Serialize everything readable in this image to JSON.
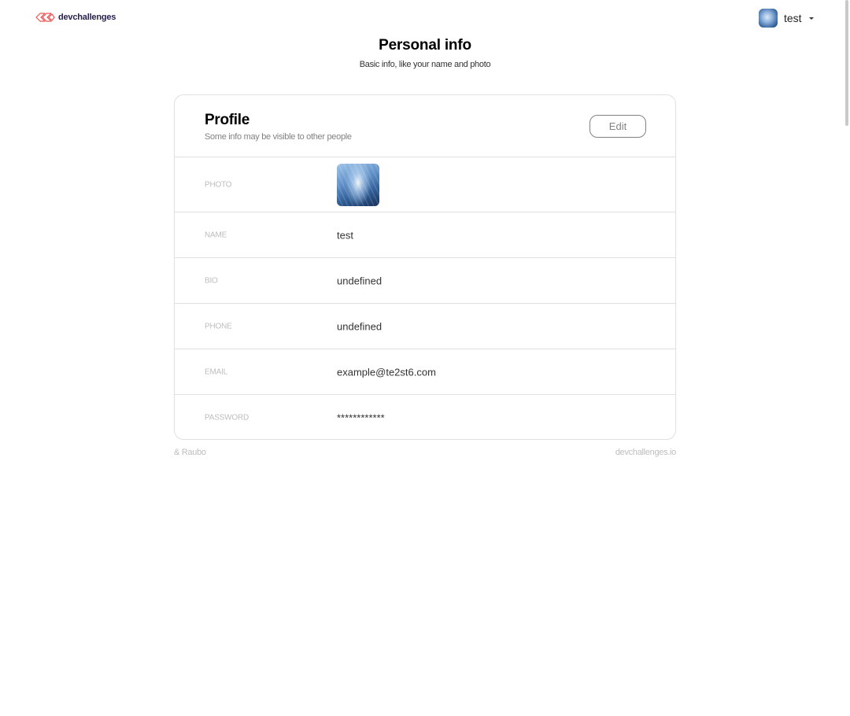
{
  "header": {
    "logo_text": "devchallenges",
    "logo_icon": "devchallenges-logo-icon",
    "user_name": "test",
    "menu_icon": "caret-down-icon"
  },
  "page": {
    "title": "Personal info",
    "subtitle": "Basic info, like your name and photo"
  },
  "profile": {
    "title": "Profile",
    "subtitle": "Some info may be visible to other people",
    "edit_label": "Edit",
    "rows": [
      {
        "label": "PHOTO",
        "value": ""
      },
      {
        "label": "NAME",
        "value": "test"
      },
      {
        "label": "BIO",
        "value": "undefined"
      },
      {
        "label": "PHONE",
        "value": "undefined"
      },
      {
        "label": "EMAIL",
        "value": "example@te2st6.com"
      },
      {
        "label": "PASSWORD",
        "value": "************"
      }
    ]
  },
  "footer": {
    "left": "& Raubo",
    "right": "devchallenges.io"
  },
  "colors": {
    "logo_accent": "#eb5757",
    "logo_text": "#282051",
    "muted_text": "#bdbdbd",
    "subtle_text": "#828282",
    "border": "#e0e0e0"
  }
}
